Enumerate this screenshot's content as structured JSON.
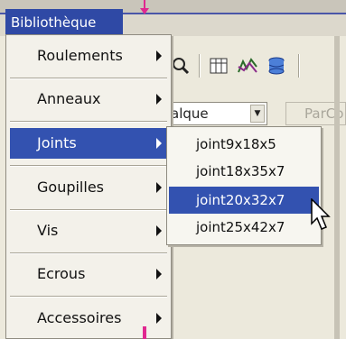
{
  "menubar": {
    "title": "Bibliothèque"
  },
  "background": {
    "combo_value": "alque",
    "combo2_value": "ParCo"
  },
  "menu": {
    "items": [
      {
        "label": "Roulements",
        "has_submenu": true,
        "active": false
      },
      {
        "label": "Anneaux",
        "has_submenu": true,
        "active": false
      },
      {
        "label": "Joints",
        "has_submenu": true,
        "active": true
      },
      {
        "label": "Goupilles",
        "has_submenu": true,
        "active": false
      },
      {
        "label": "Vis",
        "has_submenu": true,
        "active": false
      },
      {
        "label": "Ecrous",
        "has_submenu": true,
        "active": false
      },
      {
        "label": "Accessoires",
        "has_submenu": true,
        "active": false
      }
    ]
  },
  "submenu": {
    "items": [
      {
        "label": "joint9x18x5",
        "active": false
      },
      {
        "label": "joint18x35x7",
        "active": false
      },
      {
        "label": "joint20x32x7",
        "active": true
      },
      {
        "label": "joint25x42x7",
        "active": false
      }
    ]
  },
  "colors": {
    "highlight": "#3352b0",
    "accent_pink": "#e02890"
  },
  "icons": [
    "search-icon",
    "grid-icon",
    "plot-icon",
    "database-icon",
    "mouse-pointer-icon",
    "arrow-down-icon"
  ]
}
